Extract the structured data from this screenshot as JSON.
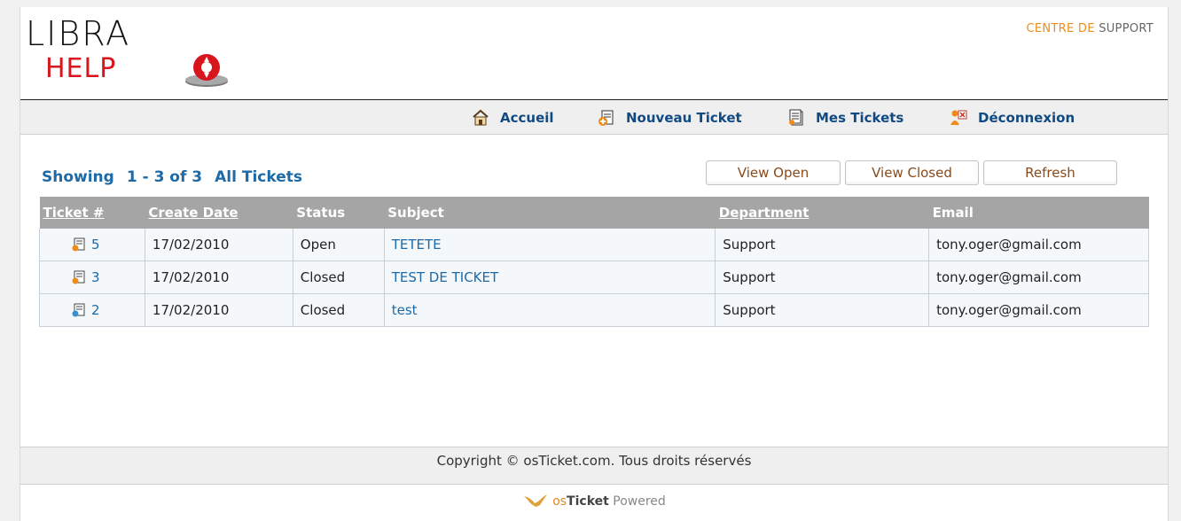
{
  "logo": {
    "line1": "LIBRA",
    "line2": "HELP"
  },
  "header": {
    "support_accent": "CENTRE DE",
    "support_rest": "SUPPORT"
  },
  "nav": [
    {
      "label": "Accueil",
      "icon": "home-icon"
    },
    {
      "label": "Nouveau Ticket",
      "icon": "new-ticket-icon"
    },
    {
      "label": "Mes Tickets",
      "icon": "my-tickets-icon"
    },
    {
      "label": "Déconnexion",
      "icon": "logout-icon"
    }
  ],
  "listing": {
    "showing_label": "Showing",
    "range": "1 - 3 of 3",
    "scope": "All Tickets"
  },
  "buttons": {
    "view_open": "View Open",
    "view_closed": "View Closed",
    "refresh": "Refresh"
  },
  "table": {
    "headers": [
      "Ticket #",
      "Create Date",
      "Status",
      "Subject",
      "Department",
      "Email"
    ],
    "rows": [
      {
        "ticket": "5",
        "date": "17/02/2010",
        "status": "Open",
        "subject": "TETETE",
        "department": "Support",
        "email": "tony.oger@gmail.com",
        "icon": "ticket-web-icon"
      },
      {
        "ticket": "3",
        "date": "17/02/2010",
        "status": "Closed",
        "subject": "TEST DE TICKET",
        "department": "Support",
        "email": "tony.oger@gmail.com",
        "icon": "ticket-web-icon"
      },
      {
        "ticket": "2",
        "date": "17/02/2010",
        "status": "Closed",
        "subject": "test",
        "department": "Support",
        "email": "tony.oger@gmail.com",
        "icon": "ticket-email-icon"
      }
    ]
  },
  "footer": {
    "copyright": "Copyright © osTicket.com. Tous droits réservés"
  },
  "powered": {
    "os": "os",
    "ticket": "Ticket",
    "rest": " Powered"
  },
  "colors": {
    "accent": "#ef8c18",
    "link": "#1d6aa6",
    "header_bg": "#a5a5a5",
    "logo_red": "#d8141c"
  }
}
